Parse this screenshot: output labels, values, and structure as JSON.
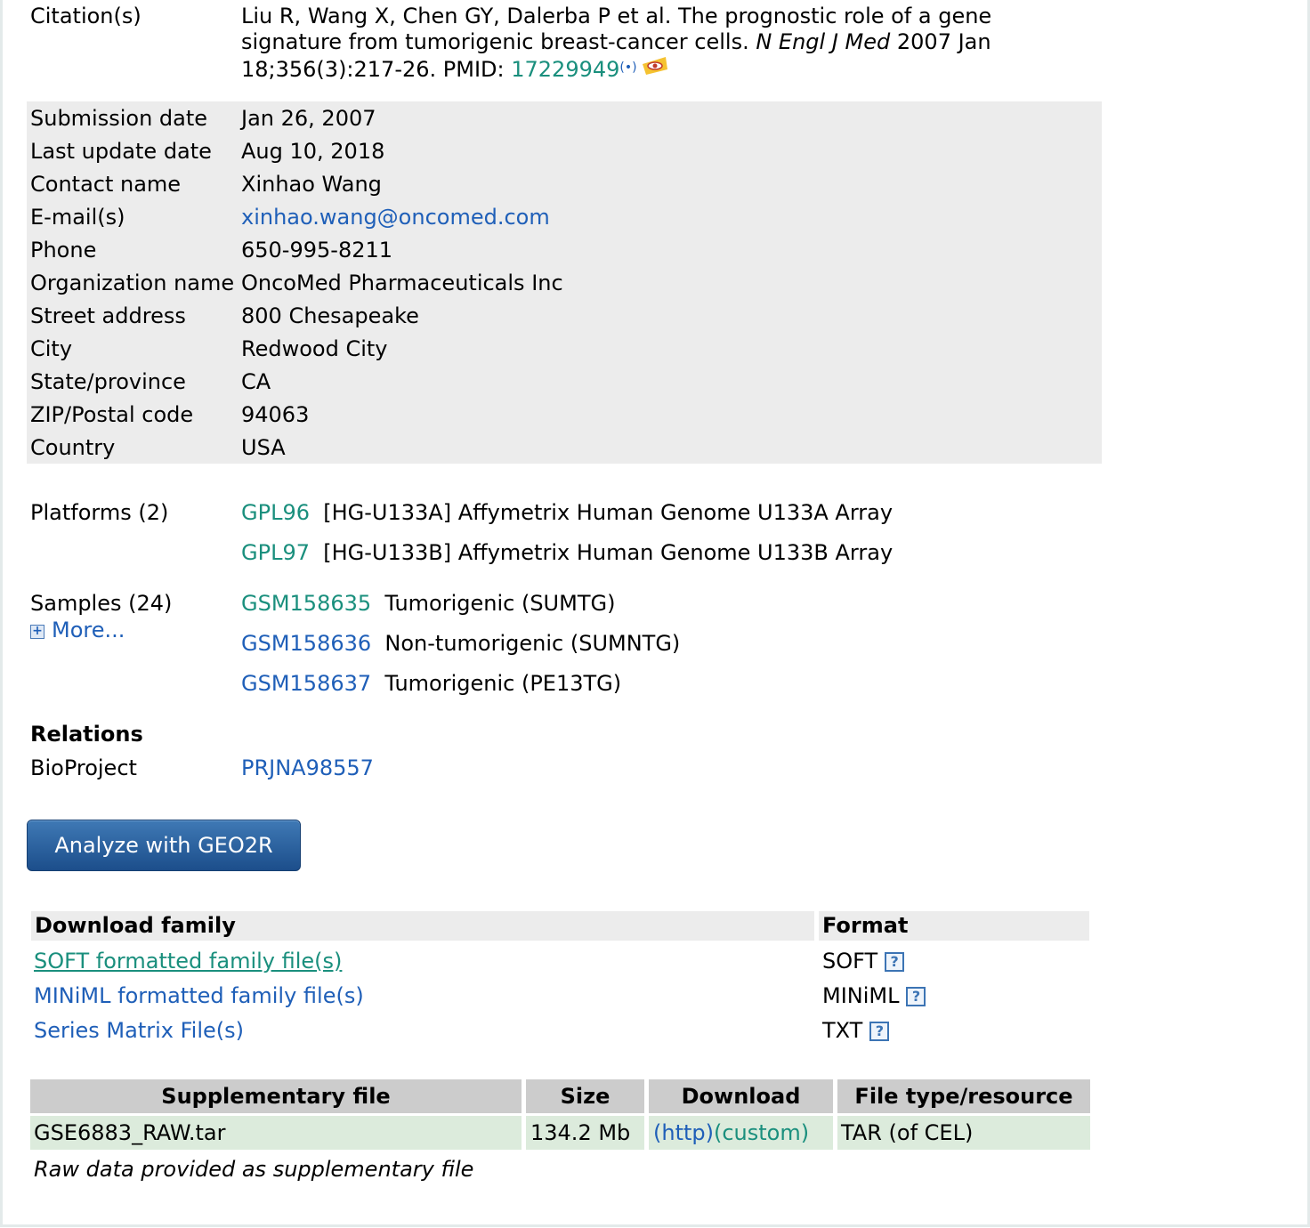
{
  "citation": {
    "label": "Citation(s)",
    "text_part1": "Liu R, Wang X, Chen GY, Dalerba P et al. The prognostic role of a gene signature from tumorigenic breast-cancer cells.",
    "journal": "N Engl J Med",
    "text_part2": "2007 Jan 18;356(3):217-26. PMID:",
    "pmid": "17229949"
  },
  "contact_rows": [
    {
      "label": "Submission date",
      "value": "Jan 26, 2007"
    },
    {
      "label": "Last update date",
      "value": "Aug 10, 2018"
    },
    {
      "label": "Contact name",
      "value": "Xinhao Wang"
    },
    {
      "label": "E-mail(s)",
      "value": "xinhao.wang@oncomed.com"
    },
    {
      "label": "Phone",
      "value": "650-995-8211"
    },
    {
      "label": "Organization name",
      "value": "OncoMed Pharmaceuticals Inc"
    },
    {
      "label": "Street address",
      "value": "800 Chesapeake"
    },
    {
      "label": "City",
      "value": "Redwood City"
    },
    {
      "label": "State/province",
      "value": "CA"
    },
    {
      "label": "ZIP/Postal code",
      "value": "94063"
    },
    {
      "label": "Country",
      "value": "USA"
    }
  ],
  "platforms": {
    "label": "Platforms (2)",
    "items": [
      {
        "id": "GPL96",
        "desc": "[HG-U133A] Affymetrix Human Genome U133A Array"
      },
      {
        "id": "GPL97",
        "desc": "[HG-U133B] Affymetrix Human Genome U133B Array"
      }
    ]
  },
  "samples": {
    "label": "Samples (24)",
    "more": "More...",
    "items": [
      {
        "id": "GSM158635",
        "desc": "Tumorigenic (SUMTG)"
      },
      {
        "id": "GSM158636",
        "desc": "Non-tumorigenic (SUMNTG)"
      },
      {
        "id": "GSM158637",
        "desc": "Tumorigenic (PE13TG)"
      }
    ]
  },
  "relations": {
    "heading": "Relations",
    "label": "BioProject",
    "value": "PRJNA98557"
  },
  "geo2r_button": "Analyze with GEO2R",
  "download_family": {
    "header": "Download family",
    "format_header": "Format",
    "rows": [
      {
        "label": "SOFT formatted family file(s)",
        "format": "SOFT"
      },
      {
        "label": "MINiML formatted family file(s)",
        "format": "MINiML"
      },
      {
        "label": "Series Matrix File(s)",
        "format": "TXT"
      }
    ]
  },
  "supplementary": {
    "headers": [
      "Supplementary file",
      "Size",
      "Download",
      "File type/resource"
    ],
    "row": {
      "file": "GSE6883_RAW.tar",
      "size": "134.2 Mb",
      "http": "(http)",
      "custom": "(custom)",
      "type": "TAR (of CEL)"
    },
    "note": "Raw data provided as supplementary file"
  },
  "help_symbol": "?",
  "colors": {
    "link": "#1f5fb8",
    "teal_link": "#1a8f7d",
    "button": "#2a5f9e"
  }
}
